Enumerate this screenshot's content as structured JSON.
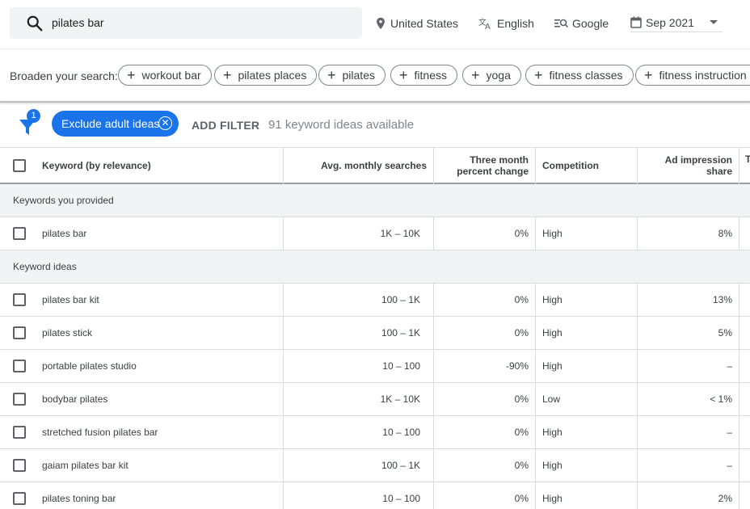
{
  "search": {
    "value": "pilates bar"
  },
  "targeting": {
    "location": "United States",
    "language": "English",
    "network": "Google",
    "date": "Sep 2021"
  },
  "broaden": {
    "label": "Broaden your search:",
    "chips": [
      "workout bar",
      "pilates places",
      "pilates",
      "fitness",
      "yoga",
      "fitness classes",
      "fitness instruction"
    ]
  },
  "filters": {
    "badge_count": "1",
    "active_filter": "Exclude adult ideas",
    "add_filter_label": "ADD FILTER",
    "ideas_count_text": "91 keyword ideas available"
  },
  "table": {
    "headers": {
      "keyword": "Keyword (by relevance)",
      "avg": "Avg. monthly searches",
      "change_line1": "Three month",
      "change_line2": "percent change",
      "competition": "Competition",
      "ad_line1": "Ad impression",
      "ad_line2": "share",
      "next": "T"
    },
    "group_provided": "Keywords you provided",
    "group_ideas": "Keyword ideas",
    "provided_rows": [
      {
        "keyword": "pilates bar",
        "avg": "1K – 10K",
        "change": "0%",
        "competition": "High",
        "ad_share": "8%"
      }
    ],
    "idea_rows": [
      {
        "keyword": "pilates bar kit",
        "avg": "100 – 1K",
        "change": "0%",
        "competition": "High",
        "ad_share": "13%"
      },
      {
        "keyword": "pilates stick",
        "avg": "100 – 1K",
        "change": "0%",
        "competition": "High",
        "ad_share": "5%"
      },
      {
        "keyword": "portable pilates studio",
        "avg": "10 – 100",
        "change": "-90%",
        "competition": "High",
        "ad_share": "–"
      },
      {
        "keyword": "bodybar pilates",
        "avg": "1K – 10K",
        "change": "0%",
        "competition": "Low",
        "ad_share": "< 1%"
      },
      {
        "keyword": "stretched fusion pilates bar",
        "avg": "10 – 100",
        "change": "0%",
        "competition": "High",
        "ad_share": "–"
      },
      {
        "keyword": "gaiam pilates bar kit",
        "avg": "100 – 1K",
        "change": "0%",
        "competition": "High",
        "ad_share": "–"
      },
      {
        "keyword": "pilates toning bar",
        "avg": "10 – 100",
        "change": "0%",
        "competition": "High",
        "ad_share": "2%"
      }
    ]
  }
}
